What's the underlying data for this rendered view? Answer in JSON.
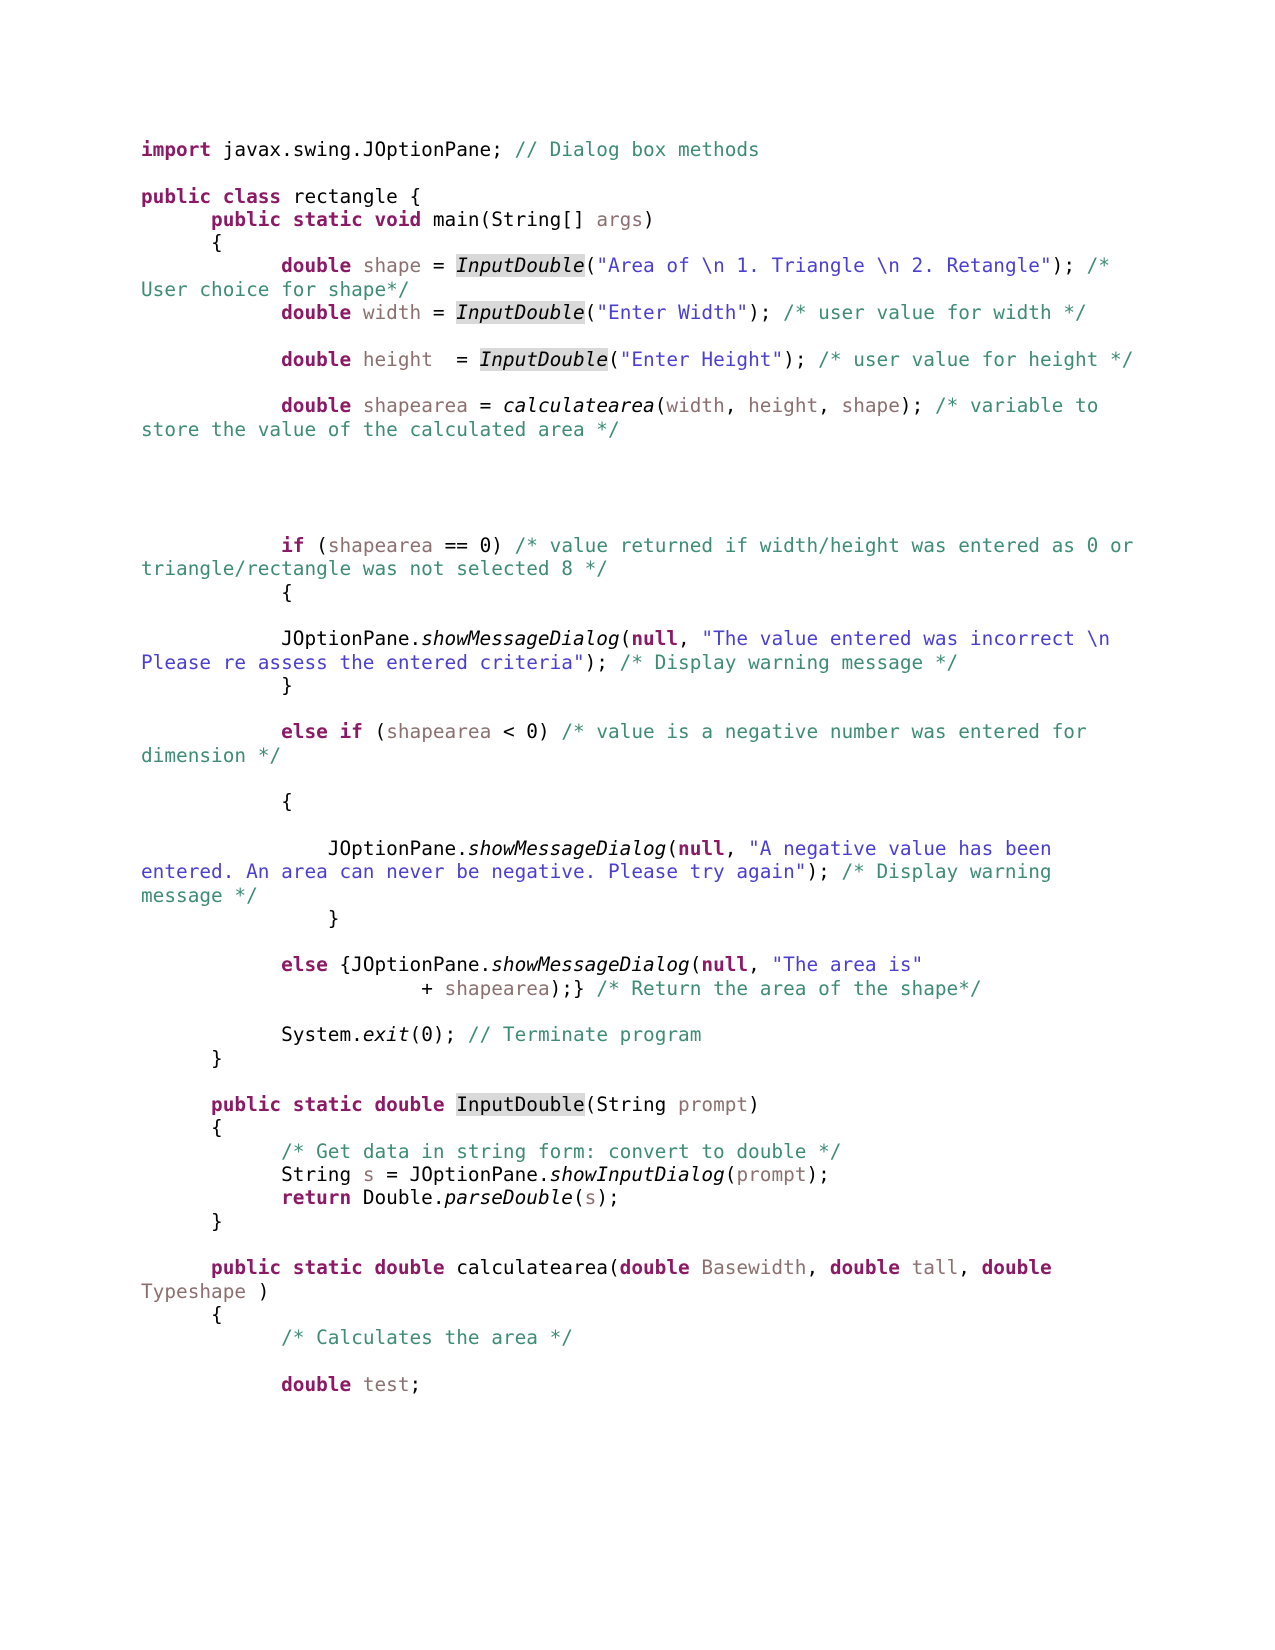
{
  "document": {
    "type": "java-source-listing",
    "language": "Java",
    "class_name": "rectangle",
    "background": "#ffffff",
    "colors": {
      "keyword": "#8B1965",
      "string": "#4A3FD0",
      "comment": "#3E8C77",
      "identifier": "#8C7070",
      "plain": "#000000",
      "highlight_background": "#d9d9d9"
    }
  },
  "code": {
    "lines": [
      {
        "id": "line-import",
        "tokens": [
          {
            "t": "kw",
            "v": "import"
          },
          {
            "t": "pl",
            "v": " javax.swing.JOptionPane; "
          },
          {
            "t": "cmt",
            "v": "// Dialog box methods"
          }
        ]
      },
      {
        "id": "line-blank-1",
        "tokens": []
      },
      {
        "id": "line-class-decl",
        "tokens": [
          {
            "t": "kw",
            "v": "public class"
          },
          {
            "t": "pl",
            "v": " rectangle {"
          }
        ]
      },
      {
        "id": "line-main-decl",
        "tokens": [
          {
            "t": "pl",
            "v": "      "
          },
          {
            "t": "kw",
            "v": "public static void"
          },
          {
            "t": "pl",
            "v": " main(String[] "
          },
          {
            "t": "var",
            "v": "args"
          },
          {
            "t": "pl",
            "v": ")"
          }
        ]
      },
      {
        "id": "line-main-open-brace",
        "tokens": [
          {
            "t": "pl",
            "v": "      {"
          }
        ]
      },
      {
        "id": "line-double-shape",
        "tokens": [
          {
            "t": "pl",
            "v": "            "
          },
          {
            "t": "kw",
            "v": "double"
          },
          {
            "t": "pl",
            "v": " "
          },
          {
            "t": "var",
            "v": "shape"
          },
          {
            "t": "pl",
            "v": " = "
          },
          {
            "t": "fn-hl",
            "v": "InputDouble"
          },
          {
            "t": "pl",
            "v": "("
          },
          {
            "t": "str",
            "v": "\"Area of \\n 1. Triangle \\n 2. Retangle\""
          },
          {
            "t": "pl",
            "v": "); "
          },
          {
            "t": "cmt",
            "v": "/* User choice for shape*/"
          }
        ]
      },
      {
        "id": "line-double-width",
        "tokens": [
          {
            "t": "pl",
            "v": "            "
          },
          {
            "t": "kw",
            "v": "double"
          },
          {
            "t": "pl",
            "v": " "
          },
          {
            "t": "var",
            "v": "width"
          },
          {
            "t": "pl",
            "v": " = "
          },
          {
            "t": "fn-hl",
            "v": "InputDouble"
          },
          {
            "t": "pl",
            "v": "("
          },
          {
            "t": "str",
            "v": "\"Enter Width\""
          },
          {
            "t": "pl",
            "v": "); "
          },
          {
            "t": "cmt",
            "v": "/* user value for width */"
          }
        ]
      },
      {
        "id": "line-blank-2",
        "tokens": []
      },
      {
        "id": "line-double-height",
        "tokens": [
          {
            "t": "pl",
            "v": "            "
          },
          {
            "t": "kw",
            "v": "double"
          },
          {
            "t": "pl",
            "v": " "
          },
          {
            "t": "var",
            "v": "height"
          },
          {
            "t": "pl",
            "v": "  = "
          },
          {
            "t": "fn-hl",
            "v": "InputDouble"
          },
          {
            "t": "pl",
            "v": "("
          },
          {
            "t": "str",
            "v": "\"Enter Height\""
          },
          {
            "t": "pl",
            "v": "); "
          },
          {
            "t": "cmt",
            "v": "/* user value for height */"
          }
        ]
      },
      {
        "id": "line-blank-3",
        "tokens": []
      },
      {
        "id": "line-double-shapearea",
        "tokens": [
          {
            "t": "pl",
            "v": "            "
          },
          {
            "t": "kw",
            "v": "double"
          },
          {
            "t": "pl",
            "v": " "
          },
          {
            "t": "var",
            "v": "shapearea"
          },
          {
            "t": "pl",
            "v": " = "
          },
          {
            "t": "fn",
            "v": "calculatearea"
          },
          {
            "t": "pl",
            "v": "("
          },
          {
            "t": "var",
            "v": "width"
          },
          {
            "t": "pl",
            "v": ", "
          },
          {
            "t": "var",
            "v": "height"
          },
          {
            "t": "pl",
            "v": ", "
          },
          {
            "t": "var",
            "v": "shape"
          },
          {
            "t": "pl",
            "v": "); "
          },
          {
            "t": "cmt",
            "v": "/* variable to store the value of the calculated area */"
          }
        ]
      },
      {
        "id": "line-blank-4",
        "tokens": []
      },
      {
        "id": "line-blank-5",
        "tokens": []
      },
      {
        "id": "line-blank-6",
        "tokens": []
      },
      {
        "id": "line-blank-7",
        "tokens": []
      },
      {
        "id": "line-if-shapearea-zero",
        "tokens": [
          {
            "t": "pl",
            "v": "            "
          },
          {
            "t": "kw",
            "v": "if"
          },
          {
            "t": "pl",
            "v": " ("
          },
          {
            "t": "var",
            "v": "shapearea"
          },
          {
            "t": "pl",
            "v": " == 0) "
          },
          {
            "t": "cmt",
            "v": "/* value returned if width/height was entered as 0 or triangle/rectangle was not selected 8 */"
          }
        ]
      },
      {
        "id": "line-if-open-brace",
        "tokens": [
          {
            "t": "pl",
            "v": "            {"
          }
        ]
      },
      {
        "id": "line-blank-8",
        "tokens": []
      },
      {
        "id": "line-show-incorrect",
        "tokens": [
          {
            "t": "pl",
            "v": "            JOptionPane."
          },
          {
            "t": "fn",
            "v": "showMessageDialog"
          },
          {
            "t": "pl",
            "v": "("
          },
          {
            "t": "kw",
            "v": "null"
          },
          {
            "t": "pl",
            "v": ", "
          },
          {
            "t": "str",
            "v": "\"The value entered was incorrect \\n Please re assess the entered criteria\""
          },
          {
            "t": "pl",
            "v": "); "
          },
          {
            "t": "cmt",
            "v": "/* Display warning message */"
          }
        ]
      },
      {
        "id": "line-if-close-brace",
        "tokens": [
          {
            "t": "pl",
            "v": "            }"
          }
        ]
      },
      {
        "id": "line-blank-9",
        "tokens": []
      },
      {
        "id": "line-else-if-negative",
        "tokens": [
          {
            "t": "pl",
            "v": "            "
          },
          {
            "t": "kw",
            "v": "else if"
          },
          {
            "t": "pl",
            "v": " ("
          },
          {
            "t": "var",
            "v": "shapearea"
          },
          {
            "t": "pl",
            "v": " < 0) "
          },
          {
            "t": "cmt",
            "v": "/* value is a negative number was entered for dimension */"
          }
        ]
      },
      {
        "id": "line-blank-10",
        "tokens": []
      },
      {
        "id": "line-elseif-open-brace",
        "tokens": [
          {
            "t": "pl",
            "v": "            {"
          }
        ]
      },
      {
        "id": "line-blank-11",
        "tokens": []
      },
      {
        "id": "line-show-negative",
        "tokens": [
          {
            "t": "pl",
            "v": "                JOptionPane."
          },
          {
            "t": "fn",
            "v": "showMessageDialog"
          },
          {
            "t": "pl",
            "v": "("
          },
          {
            "t": "kw",
            "v": "null"
          },
          {
            "t": "pl",
            "v": ", "
          },
          {
            "t": "str",
            "v": "\"A negative value has been entered. An area can never be negative. Please try again\""
          },
          {
            "t": "pl",
            "v": "); "
          },
          {
            "t": "cmt",
            "v": "/* Display warning message */"
          }
        ]
      },
      {
        "id": "line-elseif-close-brace",
        "tokens": [
          {
            "t": "pl",
            "v": "                }"
          }
        ]
      },
      {
        "id": "line-blank-12",
        "tokens": []
      },
      {
        "id": "line-else-area-is",
        "tokens": [
          {
            "t": "pl",
            "v": "            "
          },
          {
            "t": "kw",
            "v": "else"
          },
          {
            "t": "pl",
            "v": " {JOptionPane."
          },
          {
            "t": "fn",
            "v": "showMessageDialog"
          },
          {
            "t": "pl",
            "v": "("
          },
          {
            "t": "kw",
            "v": "null"
          },
          {
            "t": "pl",
            "v": ", "
          },
          {
            "t": "str",
            "v": "\"The area is\""
          }
        ]
      },
      {
        "id": "line-plus-shapearea",
        "tokens": [
          {
            "t": "pl",
            "v": "                        + "
          },
          {
            "t": "var",
            "v": "shapearea"
          },
          {
            "t": "pl",
            "v": ");} "
          },
          {
            "t": "cmt",
            "v": "/* Return the area of the shape*/"
          }
        ]
      },
      {
        "id": "line-blank-13",
        "tokens": []
      },
      {
        "id": "line-system-exit",
        "tokens": [
          {
            "t": "pl",
            "v": "            System."
          },
          {
            "t": "fn",
            "v": "exit"
          },
          {
            "t": "pl",
            "v": "(0); "
          },
          {
            "t": "cmt",
            "v": "// Terminate program"
          }
        ]
      },
      {
        "id": "line-main-close-brace",
        "tokens": [
          {
            "t": "pl",
            "v": "      }"
          }
        ]
      },
      {
        "id": "line-blank-14",
        "tokens": []
      },
      {
        "id": "line-inputdouble-decl",
        "tokens": [
          {
            "t": "pl",
            "v": "      "
          },
          {
            "t": "kw",
            "v": "public static double"
          },
          {
            "t": "pl",
            "v": " "
          },
          {
            "t": "def-hl",
            "v": "InputDouble"
          },
          {
            "t": "pl",
            "v": "(String "
          },
          {
            "t": "var",
            "v": "prompt"
          },
          {
            "t": "pl",
            "v": ")"
          }
        ]
      },
      {
        "id": "line-inputdouble-open-brace",
        "tokens": [
          {
            "t": "pl",
            "v": "      {"
          }
        ]
      },
      {
        "id": "line-comment-getdata",
        "tokens": [
          {
            "t": "pl",
            "v": "            "
          },
          {
            "t": "cmt",
            "v": "/* Get data in string form: convert to double */"
          }
        ]
      },
      {
        "id": "line-string-s",
        "tokens": [
          {
            "t": "pl",
            "v": "            String "
          },
          {
            "t": "var",
            "v": "s"
          },
          {
            "t": "pl",
            "v": " = JOptionPane."
          },
          {
            "t": "fn",
            "v": "showInputDialog"
          },
          {
            "t": "pl",
            "v": "("
          },
          {
            "t": "var",
            "v": "prompt"
          },
          {
            "t": "pl",
            "v": ");"
          }
        ]
      },
      {
        "id": "line-return-parsedouble",
        "tokens": [
          {
            "t": "pl",
            "v": "            "
          },
          {
            "t": "kw",
            "v": "return"
          },
          {
            "t": "pl",
            "v": " Double."
          },
          {
            "t": "fn",
            "v": "parseDouble"
          },
          {
            "t": "pl",
            "v": "("
          },
          {
            "t": "var",
            "v": "s"
          },
          {
            "t": "pl",
            "v": ");"
          }
        ]
      },
      {
        "id": "line-inputdouble-close-brace",
        "tokens": [
          {
            "t": "pl",
            "v": "      }"
          }
        ]
      },
      {
        "id": "line-blank-15",
        "tokens": []
      },
      {
        "id": "line-calculatearea-decl",
        "tokens": [
          {
            "t": "pl",
            "v": "      "
          },
          {
            "t": "kw",
            "v": "public static double"
          },
          {
            "t": "pl",
            "v": " calculatearea("
          },
          {
            "t": "kw",
            "v": "double"
          },
          {
            "t": "pl",
            "v": " "
          },
          {
            "t": "var",
            "v": "Basewidth"
          },
          {
            "t": "pl",
            "v": ", "
          },
          {
            "t": "kw",
            "v": "double"
          },
          {
            "t": "pl",
            "v": " "
          },
          {
            "t": "var",
            "v": "tall"
          },
          {
            "t": "pl",
            "v": ", "
          },
          {
            "t": "kw",
            "v": "double"
          },
          {
            "t": "pl",
            "v": " "
          },
          {
            "t": "var",
            "v": "Typeshape"
          },
          {
            "t": "pl",
            "v": " )"
          }
        ]
      },
      {
        "id": "line-calculatearea-open-brace",
        "tokens": [
          {
            "t": "pl",
            "v": "      {"
          }
        ]
      },
      {
        "id": "line-comment-calculates",
        "tokens": [
          {
            "t": "pl",
            "v": "            "
          },
          {
            "t": "cmt",
            "v": "/* Calculates the area */"
          }
        ]
      },
      {
        "id": "line-blank-16",
        "tokens": []
      },
      {
        "id": "line-double-test",
        "tokens": [
          {
            "t": "pl",
            "v": "            "
          },
          {
            "t": "kw",
            "v": "double"
          },
          {
            "t": "pl",
            "v": " "
          },
          {
            "t": "var",
            "v": "test"
          },
          {
            "t": "pl",
            "v": ";"
          }
        ]
      }
    ]
  }
}
